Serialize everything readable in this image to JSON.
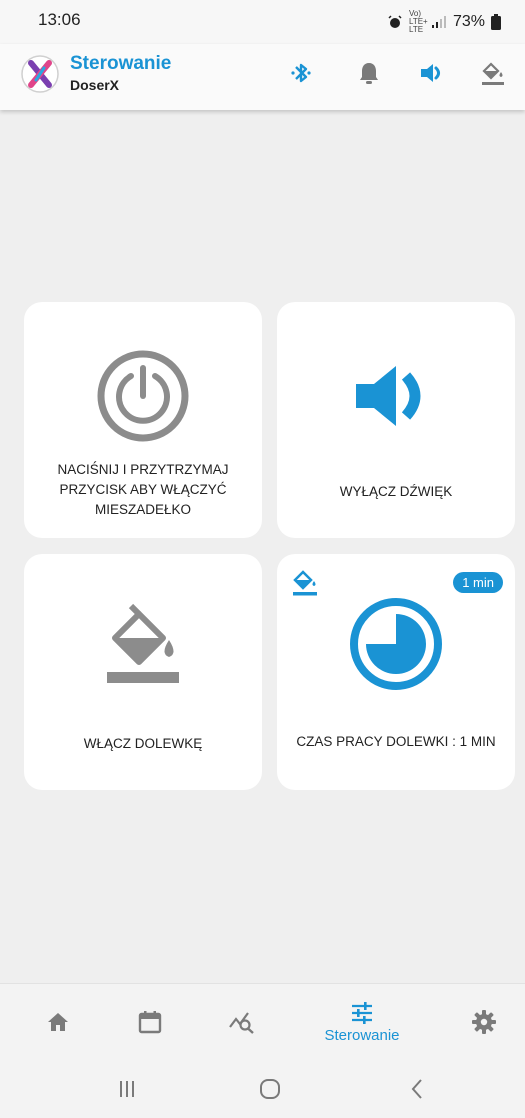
{
  "status_bar": {
    "time": "13:06",
    "network": "Vo) LTE+ LTE",
    "battery": "73%"
  },
  "header": {
    "title": "Sterowanie",
    "subtitle": "DoserX",
    "icons": [
      "bluetooth-icon",
      "bell-icon",
      "volume-icon",
      "fill-bucket-icon"
    ],
    "accent": "#1a93d4"
  },
  "cards": {
    "stirrer": {
      "label_line1": "NACIŚNIJ I PRZYTRZYMAJ",
      "label_line2": "PRZYCISK ABY WŁĄCZYĆ",
      "label_line3": "MIESZADEŁKO",
      "icon": "power-icon"
    },
    "sound": {
      "label": "WYŁĄCZ DŹWIĘK",
      "icon": "volume-icon"
    },
    "refill": {
      "label": "WŁĄCZ DOLEWKĘ",
      "icon": "fill-bucket-icon"
    },
    "refill_time": {
      "label": "CZAS PRACY DOLEWKI : 1 MIN",
      "badge": "1 min",
      "icon": "timer-icon",
      "timer_fraction": 0.75
    }
  },
  "bottom_nav": {
    "items": [
      {
        "name": "home",
        "icon": "home-icon"
      },
      {
        "name": "calendar",
        "icon": "calendar-icon"
      },
      {
        "name": "charts",
        "icon": "chart-search-icon"
      },
      {
        "name": "control",
        "icon": "sliders-icon",
        "label": "Sterowanie",
        "active": true
      },
      {
        "name": "settings",
        "icon": "gear-icon"
      }
    ],
    "active_label": "Sterowanie"
  },
  "system_nav": {
    "buttons": [
      "recents-icon",
      "home-circle-icon",
      "back-icon"
    ]
  }
}
